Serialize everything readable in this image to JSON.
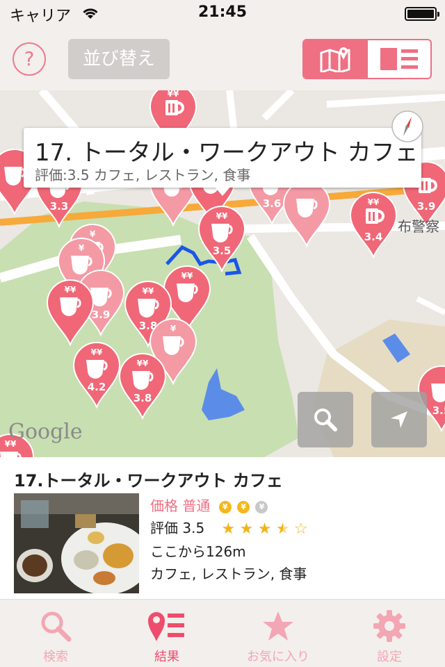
{
  "status_bar": {
    "carrier": "キャリア",
    "time": "21:45"
  },
  "toolbar": {
    "help_label": "?",
    "sort_label": "並び替え"
  },
  "map": {
    "callout": {
      "title": "17. トータル・ワークアウト カフェ",
      "subtitle": "評価:3.5 カフェ, レストラン, 食事"
    },
    "pins": [
      {
        "icon": "beer-mug-icon",
        "price": "¥¥",
        "rating": ""
      },
      {
        "icon": "coffee-cup-icon",
        "price": "",
        "rating": ""
      },
      {
        "icon": "coffee-cup-icon",
        "price": "",
        "rating": "3.3"
      },
      {
        "icon": "coffee-cup-icon",
        "price": "",
        "rating": ""
      },
      {
        "icon": "coffee-cup-icon",
        "price": "",
        "rating": ""
      },
      {
        "icon": "coffee-cup-icon",
        "price": "",
        "rating": "3.6"
      },
      {
        "icon": "coffee-cup-icon",
        "price": "",
        "rating": ""
      },
      {
        "icon": "beer-mug-icon",
        "price": "¥¥",
        "rating": "3.4"
      },
      {
        "icon": "beer-mug-icon",
        "price": "",
        "rating": "3.9"
      },
      {
        "icon": "coffee-cup-icon",
        "price": "¥¥",
        "rating": "3.5"
      },
      {
        "icon": "coffee-cup-icon",
        "price": "¥",
        "rating": ""
      },
      {
        "icon": "coffee-cup-icon",
        "price": "¥",
        "rating": ""
      },
      {
        "icon": "coffee-cup-icon",
        "price": "",
        "rating": "3.9"
      },
      {
        "icon": "coffee-cup-icon",
        "price": "¥¥",
        "rating": ""
      },
      {
        "icon": "coffee-cup-icon",
        "price": "¥¥",
        "rating": ""
      },
      {
        "icon": "coffee-cup-icon",
        "price": "¥¥",
        "rating": "3.8"
      },
      {
        "icon": "coffee-cup-icon",
        "price": "¥",
        "rating": ""
      },
      {
        "icon": "coffee-cup-icon",
        "price": "¥¥",
        "rating": "4.2"
      },
      {
        "icon": "coffee-cup-icon",
        "price": "¥¥",
        "rating": "3.8"
      },
      {
        "icon": "coffee-cup-icon",
        "price": "",
        "rating": "3.5"
      },
      {
        "icon": "coffee-cup-icon",
        "price": "¥¥",
        "rating": ""
      }
    ],
    "label_fuke": "布警察",
    "logo": "Google"
  },
  "info": {
    "title": "17.トータル・ワークアウト カフェ",
    "price_label": "価格 普通",
    "price_coins": [
      "¥",
      "¥",
      "¥"
    ],
    "price_level": 2,
    "rating_label": "評価 3.5",
    "rating_value": 3.5,
    "rating_max": 5,
    "distance": "ここから126m",
    "categories": "カフェ, レストラン, 食事"
  },
  "tabbar": {
    "tabs": [
      {
        "label": "検索",
        "icon": "search-icon"
      },
      {
        "label": "結果",
        "icon": "pin-list-icon"
      },
      {
        "label": "お気に入り",
        "icon": "star-icon"
      },
      {
        "label": "設定",
        "icon": "gear-icon"
      }
    ],
    "active_index": 1
  },
  "colors": {
    "accent": "#ef6f83",
    "pin": "#f06777",
    "pin_light": "#f49aa5",
    "park": "#c8dfb1",
    "water": "#5b8de8",
    "coin": "#f3b81f"
  }
}
